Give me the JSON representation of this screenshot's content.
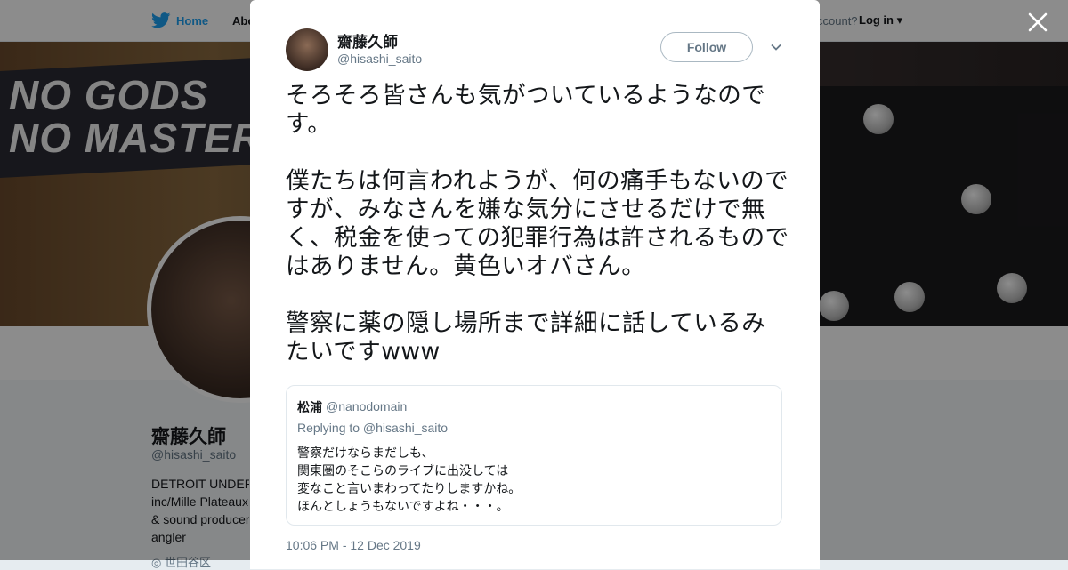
{
  "topbar": {
    "home_label": "Home",
    "about_label": "Abo",
    "account_text": "ccount?",
    "login_label": "Log in"
  },
  "banner": {
    "line1": "NO GODS",
    "line2": "NO MASTER"
  },
  "profile": {
    "name": "齋藤久師",
    "handle": "@hisashi_saito",
    "bio_lines": [
      "DETROIT UNDER",
      "inc/Mille Plateaux",
      "& sound producer",
      "angler"
    ],
    "bio_cut": "◎ 世田谷区"
  },
  "tweet": {
    "author_name": "齋藤久師",
    "author_handle": "@hisashi_saito",
    "follow_label": "Follow",
    "text": "そろそろ皆さんも気がついているようなのです。\n\n僕たちは何言われようが、何の痛手もないのですが、みなさんを嫌な気分にさせるだけで無く、税金を使っての犯罪行為は許されるものではありません。黄色いオバさん。\n\n警察に薬の隠し場所まで詳細に話しているみたいですwww",
    "timestamp": "10:06 PM - 12 Dec 2019"
  },
  "quote": {
    "name": "松浦",
    "handle": "@nanodomain",
    "replying_to": "Replying to @hisashi_saito",
    "text": "警察だけならまだしも、\n関東圏のそこらのライブに出没しては\n変なこと言いまわってたりしますかね。\nほんとしょうもないですよね・・・。"
  },
  "colors": {
    "accent": "#1da1f2",
    "muted": "#657786",
    "text": "#14171a"
  },
  "icons": {
    "brand": "twitter-bird-icon",
    "close": "close-icon",
    "menu": "chevron-down-icon"
  }
}
